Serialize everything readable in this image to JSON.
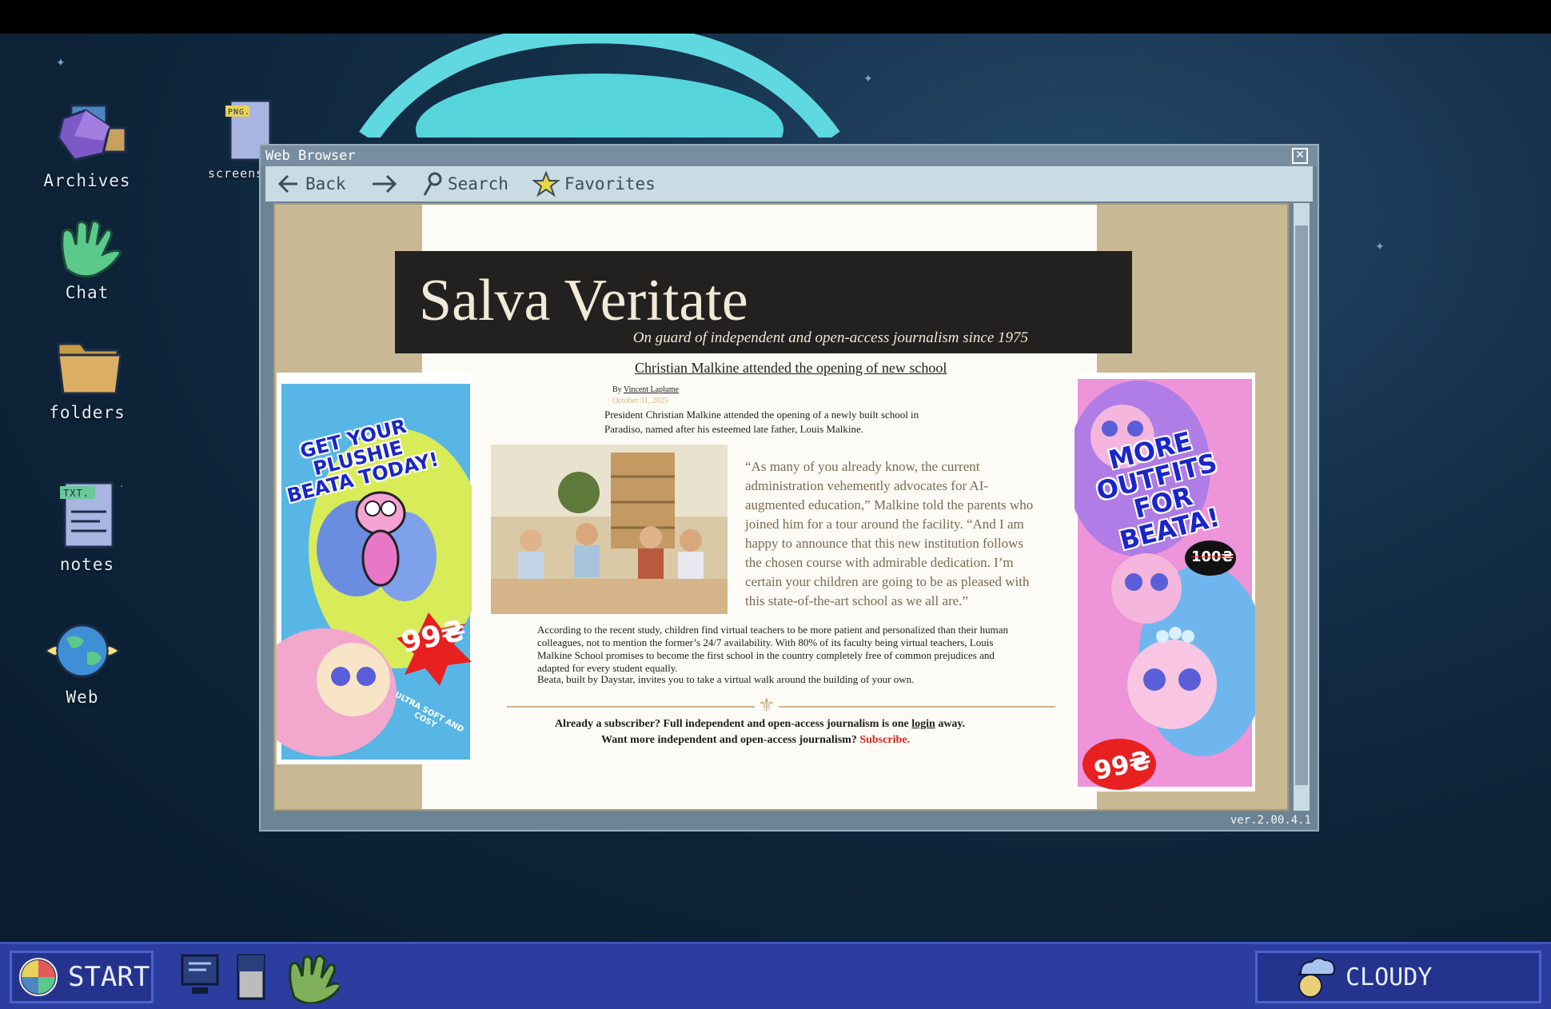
{
  "desktop": {
    "icons": [
      {
        "label": "Archives",
        "icon": "archive-crystal-icon"
      },
      {
        "label": "screens",
        "icon": "png-file-icon",
        "badge": "PNG."
      },
      {
        "label": "Chat",
        "icon": "hand-icon"
      },
      {
        "label": "folders",
        "icon": "folder-icon"
      },
      {
        "label": "notes",
        "icon": "txt-file-icon",
        "badge": "TXT."
      },
      {
        "label": "Web",
        "icon": "globe-icon"
      }
    ]
  },
  "browser": {
    "title": "Web Browser",
    "toolbar": {
      "back_label": "Back",
      "search_label": "Search",
      "favorites_label": "Favorites"
    },
    "version": "ver.2.00.4.1"
  },
  "article": {
    "masthead_title": "Salva Veritate",
    "masthead_tagline": "On guard of independent and open-access journalism since 1975",
    "headline": "Christian Malkine attended the opening of new school",
    "byline_prefix": "By",
    "author": "Vincent Laplume",
    "date": "October 31, 2025",
    "paragraph1": "President Christian Malkine attended the opening of a newly built school in Paradiso, named after his esteemed late father, Louis Malkine.",
    "quote": "“As many of you already know, the current administration vehemently advocates for AI-augmented education,” Malkine told the parents who joined him for a tour around the facility. “And I am happy to announce that this new institution follows the chosen course with admirable dedication. I’m certain your children are going to be as pleased with this state-of-the-art school as we all are.”",
    "paragraph2": "According to the recent study, children find virtual teachers to be more patient and personalized than their human colleagues, not to mention the former’s 24/7 availability. With 80% of its faculty being virtual teachers, Louis Malkine School promises to become the first school in the country completely free of common prejudices and adapted for every student equally.",
    "paragraph3": "Beata, built by Daystar, invites you to take a virtual walk around the building of your own.",
    "subscriber_line_a": "Already a subscriber? Full independent and open-access journalism is one ",
    "subscriber_login": "login",
    "subscriber_line_b": " away.",
    "subscribe_prompt": "Want more independent and open-access journalism? ",
    "subscribe_link": "Subscribe."
  },
  "ads": {
    "left": {
      "headline": "GET YOUR PLUSHIE BEATA TODAY!",
      "price": "99₴",
      "tagline": "ULTRA SOFT AND COSY"
    },
    "right": {
      "headline": "MORE OUTFITS FOR BEATA!",
      "old_price": "100₴",
      "price": "99₴"
    }
  },
  "taskbar": {
    "start_label": "START",
    "weather_label": "CLOUDY"
  },
  "colors": {
    "taskbar": "#2b3d9f",
    "browser_frame": "#6d8496",
    "masthead": "#232120",
    "page_bg": "#c8b994",
    "subscribe_red": "#d1271e"
  }
}
